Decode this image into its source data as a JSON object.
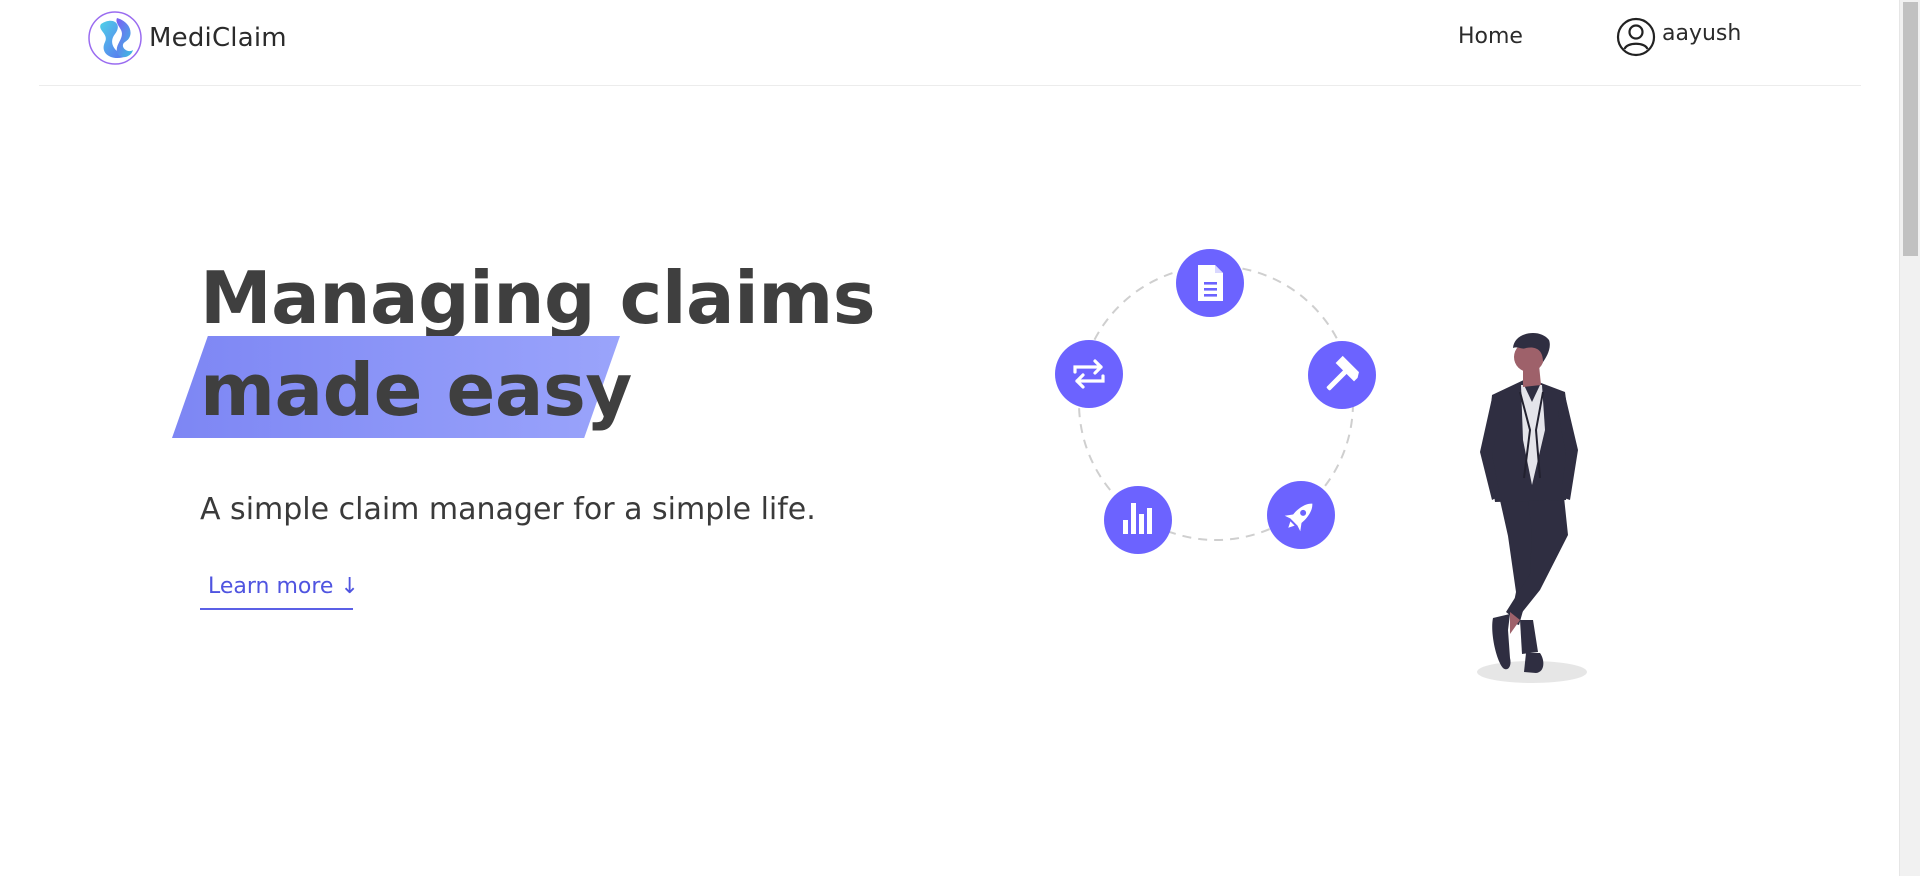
{
  "header": {
    "brand_name": "MediClaim",
    "nav_home": "Home",
    "user_name": "aayush"
  },
  "hero": {
    "title_line1": "Managing claims",
    "title_line2": "made easy",
    "subtitle": "A simple claim manager for a simple life.",
    "learn_more": "Learn more ↓"
  },
  "illustration": {
    "icons": [
      "document-icon",
      "hammer-icon",
      "rocket-icon",
      "bar-chart-icon",
      "repeat-icon"
    ]
  },
  "colors": {
    "accent": "#6c63ff",
    "highlight_start": "#7d86f4",
    "highlight_end": "#9aa4fb",
    "link": "#4f54e0"
  }
}
